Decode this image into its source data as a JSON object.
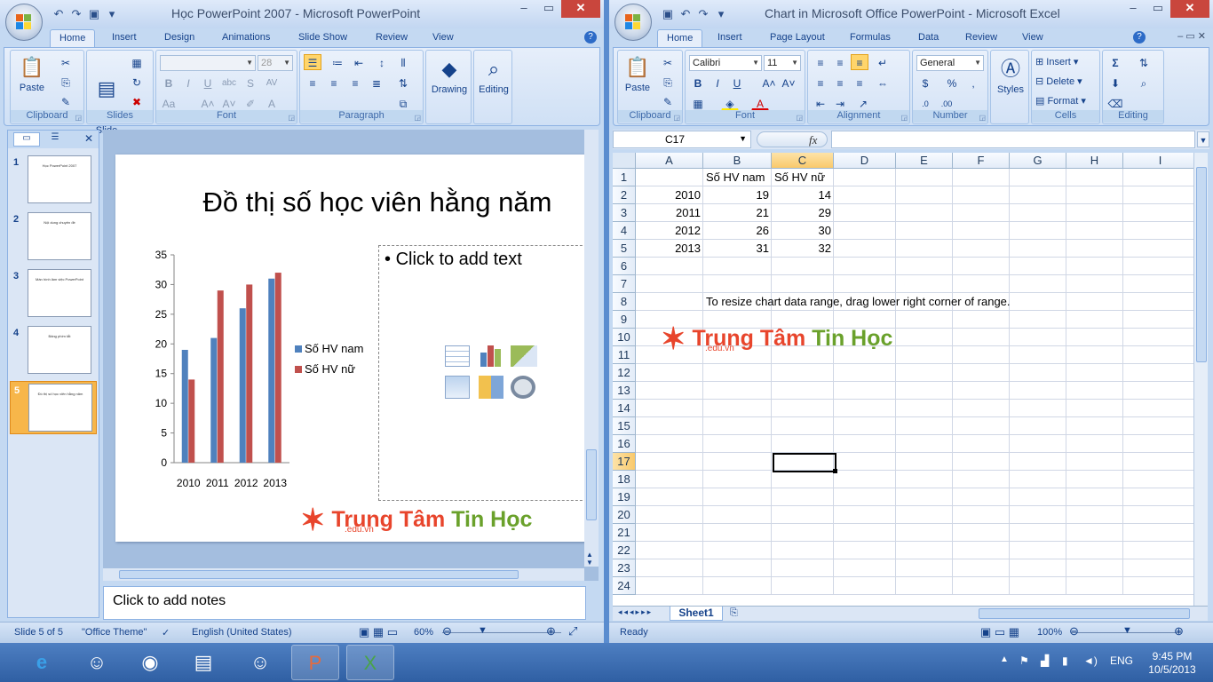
{
  "ppt": {
    "title": "Học PowerPoint 2007 - Microsoft PowerPoint",
    "tabs": [
      "Home",
      "Insert",
      "Design",
      "Animations",
      "Slide Show",
      "Review",
      "View"
    ],
    "groups": {
      "clipboard": "Clipboard",
      "slides": "Slides",
      "font": "Font",
      "paragraph": "Paragraph"
    },
    "buttons": {
      "paste": "Paste",
      "new_slide": "New\nSlide",
      "drawing": "Drawing",
      "editing": "Editing"
    },
    "font_size": "28",
    "thumbnails": [
      {
        "num": "1",
        "text": "Học PowerPoint 2007"
      },
      {
        "num": "2",
        "text": "Nội dung chuyên đề"
      },
      {
        "num": "3",
        "text": "Màn hình làm việc PowerPoint"
      },
      {
        "num": "4",
        "text": "Bảng phím tắt"
      },
      {
        "num": "5",
        "text": "Đồ thị số học viên hằng năm"
      }
    ],
    "slide_title": "Đồ thị số học viên hằng năm",
    "placeholder": "Click to add text",
    "notes": "Click to add notes",
    "status": {
      "slide": "Slide 5 of 5",
      "theme": "\"Office Theme\"",
      "lang": "English (United States)",
      "zoom": "60%"
    }
  },
  "chart_data": {
    "type": "bar",
    "categories": [
      "2010",
      "2011",
      "2012",
      "2013"
    ],
    "series": [
      {
        "name": "Số HV nam",
        "values": [
          19,
          21,
          26,
          31
        ],
        "color": "#4f81bd"
      },
      {
        "name": "Số HV nữ",
        "values": [
          14,
          29,
          30,
          32
        ],
        "color": "#c0504d"
      }
    ],
    "ylim": [
      0,
      35
    ],
    "yticks": [
      "0",
      "5",
      "10",
      "15",
      "20",
      "25",
      "30",
      "35"
    ],
    "legend": "right"
  },
  "excel": {
    "title": "Chart in Microsoft Office PowerPoint - Microsoft Excel",
    "tabs": [
      "Home",
      "Insert",
      "Page Layout",
      "Formulas",
      "Data",
      "Review",
      "View"
    ],
    "groups": {
      "clipboard": "Clipboard",
      "font": "Font",
      "alignment": "Alignment",
      "number": "Number",
      "cells": "Cells",
      "editing": "Editing"
    },
    "buttons": {
      "paste": "Paste",
      "styles": "Styles",
      "insert": "Insert",
      "delete": "Delete",
      "format": "Format"
    },
    "font_name": "Calibri",
    "font_size": "11",
    "number_format": "General",
    "name_box": "C17",
    "fx": "fx",
    "columns": [
      "A",
      "B",
      "C",
      "D",
      "E",
      "F",
      "G",
      "H",
      "I"
    ],
    "rows": [
      "1",
      "2",
      "3",
      "4",
      "5",
      "6",
      "7",
      "8",
      "9",
      "10",
      "11",
      "12",
      "13",
      "14",
      "15",
      "16",
      "17",
      "18",
      "19",
      "20",
      "21",
      "22",
      "23",
      "24"
    ],
    "header_row": [
      "",
      "Số HV nam",
      "Số HV nữ"
    ],
    "data_rows": [
      [
        "2010",
        "19",
        "14"
      ],
      [
        "2011",
        "21",
        "29"
      ],
      [
        "2012",
        "26",
        "30"
      ],
      [
        "2013",
        "31",
        "32"
      ]
    ],
    "note": "To resize chart data range, drag lower right corner of range.",
    "sheet": "Sheet1",
    "status": {
      "ready": "Ready",
      "zoom": "100%"
    }
  },
  "watermark": {
    "red": "Trung Tâm ",
    "green": "Tin Học",
    "sub": ".edu.vn"
  },
  "taskbar": {
    "lang": "ENG",
    "time": "9:45 PM",
    "date": "10/5/2013"
  }
}
